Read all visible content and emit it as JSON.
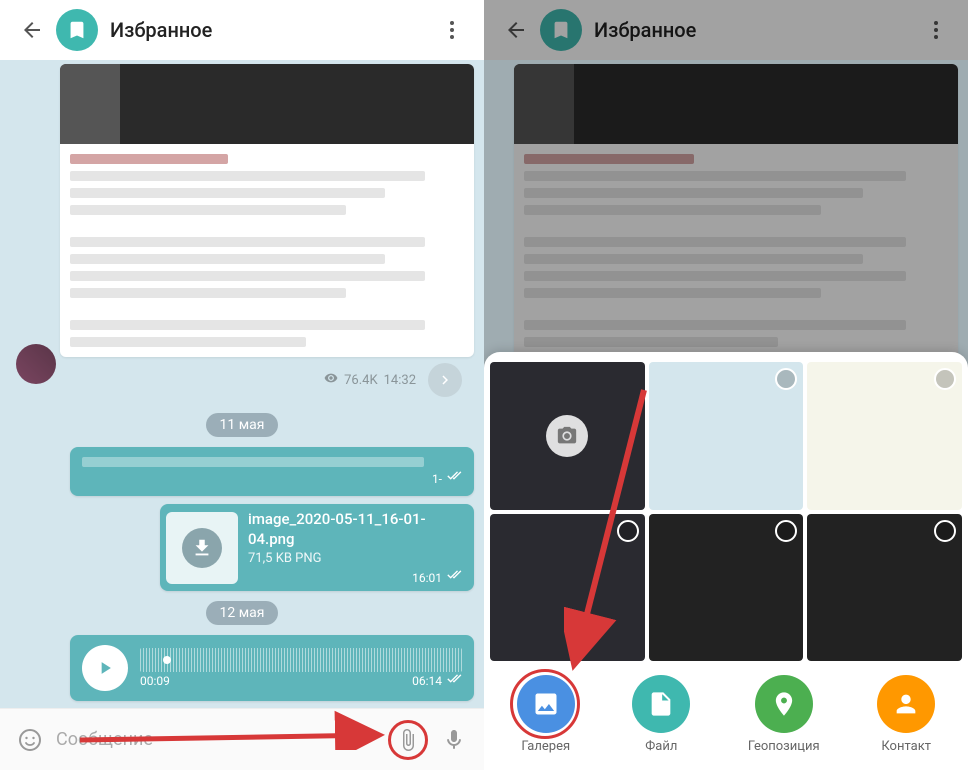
{
  "header": {
    "title": "Избранное"
  },
  "chat": {
    "views": "76.4K",
    "time1": "14:32",
    "date1": "11 мая",
    "bubble1_time": "1-",
    "file": {
      "name": "image_2020-05-11_16-01-04.png",
      "size": "71,5 KB PNG",
      "time": "16:01"
    },
    "date2": "12 мая",
    "audio": {
      "position": "00:09",
      "duration": "06:14"
    }
  },
  "input": {
    "placeholder": "Сообщение"
  },
  "attach": {
    "gallery": "Галерея",
    "file": "Файл",
    "location": "Геопозиция",
    "contact": "Контакт"
  }
}
